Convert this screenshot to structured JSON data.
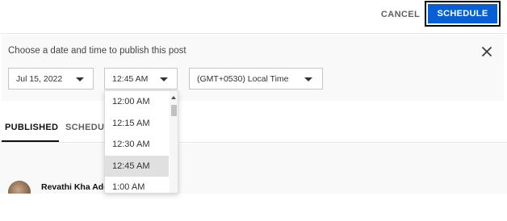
{
  "header": {
    "cancel_label": "CANCEL",
    "schedule_label": "SCHEDULE",
    "accent_color": "#065fd4"
  },
  "schedule_panel": {
    "prompt": "Choose a date and time to publish this post",
    "close_icon": "close-icon",
    "date_value": "Jul 15, 2022",
    "time_value": "12:45 AM",
    "timezone_value": "(GMT+0530) Local Time"
  },
  "time_dropdown": {
    "options": [
      "12:00 AM",
      "12:15 AM",
      "12:30 AM",
      "12:45 AM",
      "1:00 AM"
    ],
    "selected": "12:45 AM"
  },
  "tabs": {
    "published": "PUBLISHED",
    "scheduled": "SCHEDULED"
  },
  "comment": {
    "author": "Revathi Kha Adda"
  }
}
